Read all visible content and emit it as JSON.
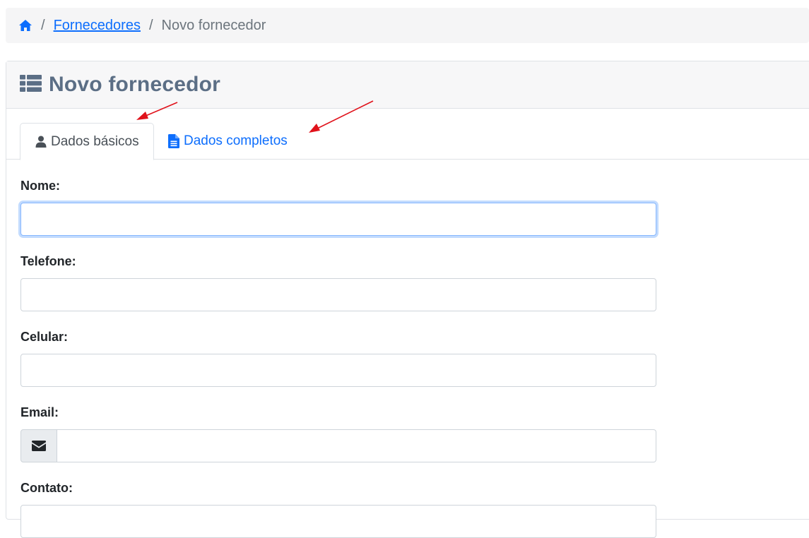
{
  "breadcrumb": {
    "home_icon": "home-icon",
    "separator": "/",
    "parent": "Fornecedores",
    "current": "Novo fornecedor"
  },
  "card": {
    "title_icon": "list-icon",
    "title": "Novo fornecedor"
  },
  "tabs": [
    {
      "label": "Dados básicos",
      "icon": "user-icon",
      "active": true
    },
    {
      "label": "Dados completos",
      "icon": "file-icon",
      "active": false
    }
  ],
  "form": {
    "fields": [
      {
        "label": "Nome:",
        "value": ""
      },
      {
        "label": "Telefone:",
        "value": ""
      },
      {
        "label": "Celular:",
        "value": ""
      },
      {
        "label": "Email:",
        "value": "",
        "addon_icon": "envelope-icon"
      },
      {
        "label": "Contato:",
        "value": ""
      }
    ]
  },
  "colors": {
    "link": "#0d6efd",
    "title": "#5b6e85",
    "annotation_arrow": "#e0121b"
  }
}
